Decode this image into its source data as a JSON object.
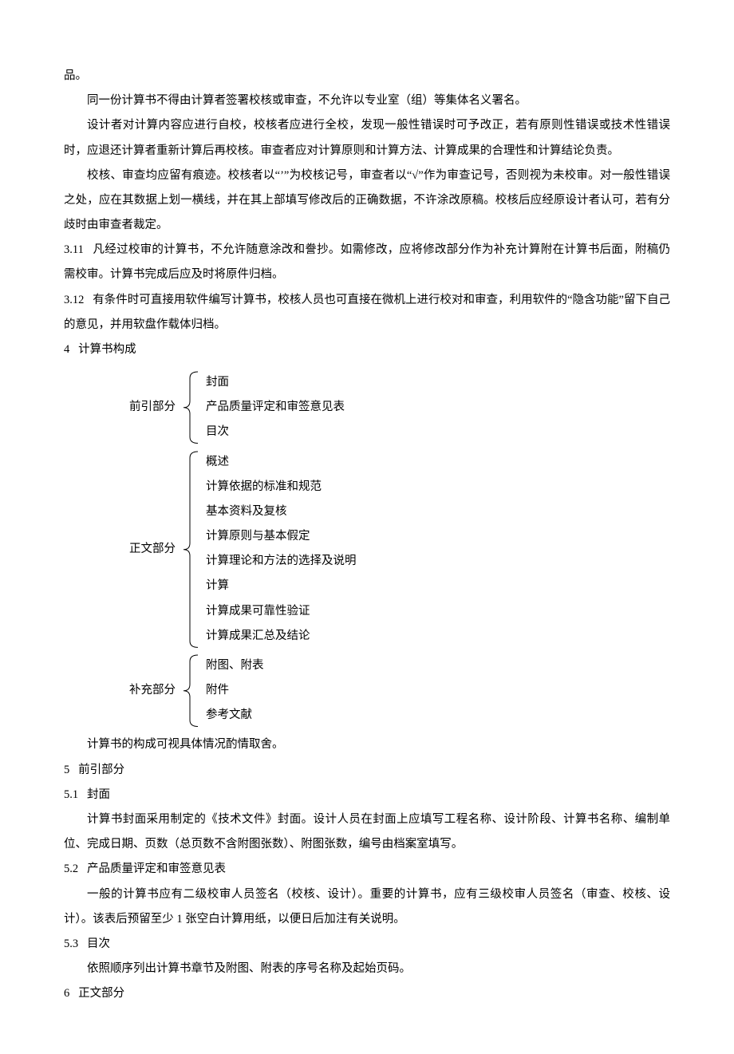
{
  "top": {
    "pin": "品。"
  },
  "intro": {
    "p1": "同一份计算书不得由计算者签署校核或审查，不允许以专业室（组）等集体名义署名。",
    "p2": "设计者对计算内容应进行自校，校核者应进行全校，发现一般性错误时可予改正，若有原则性错误或技术性错误时，应退还计算者重新计算后再校核。审查者应对计算原则和计算方法、计算成果的合理性和计算结论负责。",
    "p3": "校核、审查均应留有痕迹。校核者以“’”为校核记号，审查者以“√”作为审查记号，否则视为未校审。对一般性错误之处，应在其数据上划一横线，并在其上部填写修改后的正确数据，不许涂改原稿。校核后应经原设计者认可，若有分歧时由审查者裁定。"
  },
  "s3_11": {
    "num": "3.11",
    "text": "凡经过校审的计算书，不允许随意涂改和誊抄。如需修改，应将修改部分作为补充计算附在计算书后面，附稿仍需校审。计算书完成后应及时将原件归档。"
  },
  "s3_12": {
    "num": "3.12",
    "text": "有条件时可直接用软件编写计算书，校核人员也可直接在微机上进行校对和审查，利用软件的“隐含功能”留下自己的意见，并用软盘作载体归档。"
  },
  "s4": {
    "num": "4",
    "title": "计算书构成",
    "groups": [
      {
        "label": "前引部分",
        "items": [
          "封面",
          "产品质量评定和审签意见表",
          "目次"
        ]
      },
      {
        "label": "正文部分",
        "items": [
          "概述",
          "计算依据的标准和规范",
          "基本资料及复核",
          "计算原则与基本假定",
          "计算理论和方法的选择及说明",
          "计算",
          "计算成果可靠性验证",
          "计算成果汇总及结论"
        ]
      },
      {
        "label": "补充部分",
        "items": [
          "附图、附表",
          "附件",
          "参考文献"
        ]
      }
    ],
    "tail": "计算书的构成可视具体情况酌情取舍。"
  },
  "s5": {
    "num": "5",
    "title": "前引部分",
    "s5_1": {
      "num": "5.1",
      "title": "封面",
      "body": "计算书封面采用制定的《技术文件》封面。设计人员在封面上应填写工程名称、设计阶段、计算书名称、编制单位、完成日期、页数（总页数不含附图张数）、附图张数，编号由档案室填写。"
    },
    "s5_2": {
      "num": "5.2",
      "title": "产品质量评定和审签意见表",
      "body": "一般的计算书应有二级校审人员签名（校核、设计）。重要的计算书，应有三级校审人员签名（审查、校核、设计）。该表后预留至少 1 张空白计算用纸，以便日后加注有关说明。"
    },
    "s5_3": {
      "num": "5.3",
      "title": "目次",
      "body": "依照顺序列出计算书章节及附图、附表的序号名称及起始页码。"
    }
  },
  "s6": {
    "num": "6",
    "title": "正文部分"
  }
}
